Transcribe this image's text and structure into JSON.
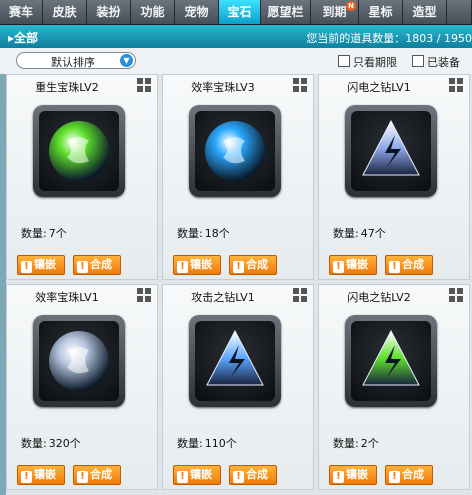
{
  "tabs": [
    {
      "label": "赛车",
      "w": 43
    },
    {
      "label": "皮肤",
      "w": 44
    },
    {
      "label": "装扮",
      "w": 44
    },
    {
      "label": "功能",
      "w": 44
    },
    {
      "label": "宠物",
      "w": 44
    },
    {
      "label": "宝石",
      "w": 42,
      "active": true
    },
    {
      "label": "愿望栏",
      "w": 50
    },
    {
      "label": "到期",
      "w": 48,
      "badge": "N"
    },
    {
      "label": "星标",
      "w": 44
    },
    {
      "label": "造型",
      "w": 44
    },
    {
      "label": "",
      "w": 25
    }
  ],
  "subheader": {
    "all_label": "▸全部",
    "count_text": "您当前的道具数量：1803 / 1950"
  },
  "filter": {
    "sort_value": "默认排序",
    "only_limited": "只看期限",
    "equipped": "已装备"
  },
  "labels": {
    "qty_prefix": "数量:",
    "inlay": "镶嵌",
    "synth": "合成"
  },
  "items": [
    {
      "name": "重生宝珠LV2",
      "qty": "7个",
      "icon": "green-orb-icon",
      "color": "#5fe02c"
    },
    {
      "name": "效率宝珠LV3",
      "qty": "18个",
      "icon": "blue-orb-icon",
      "color": "#2aa8ff"
    },
    {
      "name": "闪电之钻LV1",
      "qty": "47个",
      "icon": "lightning-diamond-icon",
      "color": "#8ea8e8"
    },
    {
      "name": "效率宝珠LV1",
      "qty": "320个",
      "icon": "silver-orb-icon",
      "color": "#b8c6e0"
    },
    {
      "name": "攻击之钻LV1",
      "qty": "110个",
      "icon": "attack-diamond-icon",
      "color": "#5aa6ff"
    },
    {
      "name": "闪电之钻LV2",
      "qty": "2个",
      "icon": "green-lightning-diamond-icon",
      "color": "#5ee02a"
    }
  ]
}
